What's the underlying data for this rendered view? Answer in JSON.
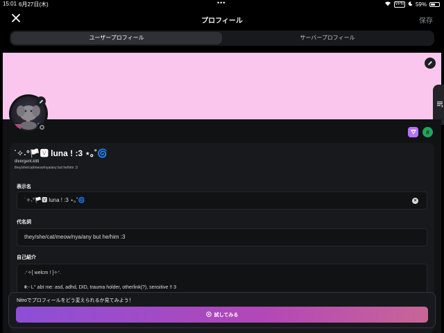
{
  "status_bar": {
    "time": "15:01",
    "date": "6月27日(木)",
    "vpn": "VPN",
    "battery": "59%",
    "battery_level": 0.59
  },
  "nav": {
    "title": "プロフィール",
    "save_label": "保存",
    "close_icon": "close-icon"
  },
  "tabs": [
    {
      "label": "ユーザープロフィール",
      "active": true
    },
    {
      "label": "サーバープロフィール",
      "active": false
    }
  ],
  "banner": {
    "color": "#fbc6ee"
  },
  "profile": {
    "display_name": "˙✧˖°🏳️🆅 luna ! :3 ⋆｡˚🌀",
    "username": "divergent.kitti",
    "pronouns_line": "they/she/cat/meow/nya/any but he/him :3"
  },
  "form": {
    "display_name_label": "表示名",
    "display_name_value": "˙✧˖°🏳️🆅 luna ! :3 ⋆｡˚🌀",
    "pronouns_label": "代名詞",
    "pronouns_value": "they/she/cat/meow/nya/any but he/him :3",
    "about_label": "自己紹介",
    "about_lines": [
      ".ᐟ✧[ welcm ! ]✧ᐟ.",
      "⩩:- Ꮮ° abt me: asd, adhd, DID, trauma holder, otherlink(?), sensitive !! 3"
    ]
  },
  "nitro": {
    "prompt": "Nitroでプロフィールをどう変えられるか見てみよう！",
    "button_label": "試してみる"
  },
  "colors": {
    "accent_start": "#8c4fd6",
    "accent_end": "#c76696",
    "nitro_badge": "#b473f5",
    "hash_badge": "#23a55a"
  }
}
